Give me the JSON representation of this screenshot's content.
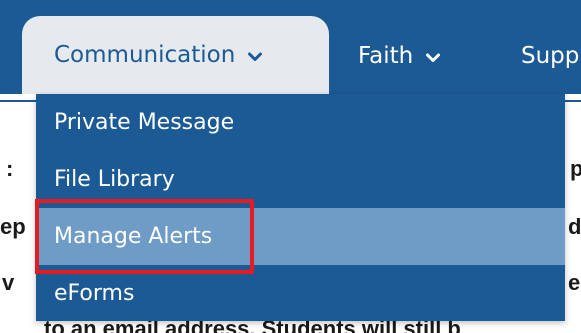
{
  "nav": {
    "items": [
      {
        "label": "Communication",
        "icon": "chevron-down-icon",
        "active": true
      },
      {
        "label": "Faith",
        "icon": "chevron-down-icon",
        "active": false
      },
      {
        "label": "Supp",
        "icon": "",
        "active": false
      }
    ]
  },
  "dropdown": {
    "items": [
      {
        "label": "Private Message",
        "highlighted": false
      },
      {
        "label": "File Library",
        "highlighted": false
      },
      {
        "label": "Manage Alerts",
        "highlighted": true
      },
      {
        "label": "eForms",
        "highlighted": false
      }
    ]
  },
  "background_text": {
    "left_fragments": [
      ":",
      "ep",
      "v"
    ],
    "right_fragments": [
      "p",
      "d",
      "e"
    ],
    "bottom_line": "to an email address. Students will still b"
  },
  "colors": {
    "nav_background": "#1c5a96",
    "active_tab_background": "#e6e9ee",
    "active_tab_text": "#1c5a96",
    "menu_text": "#ffffff",
    "highlight_background": "#6e9cc7",
    "annotation_border": "#e41b23"
  }
}
